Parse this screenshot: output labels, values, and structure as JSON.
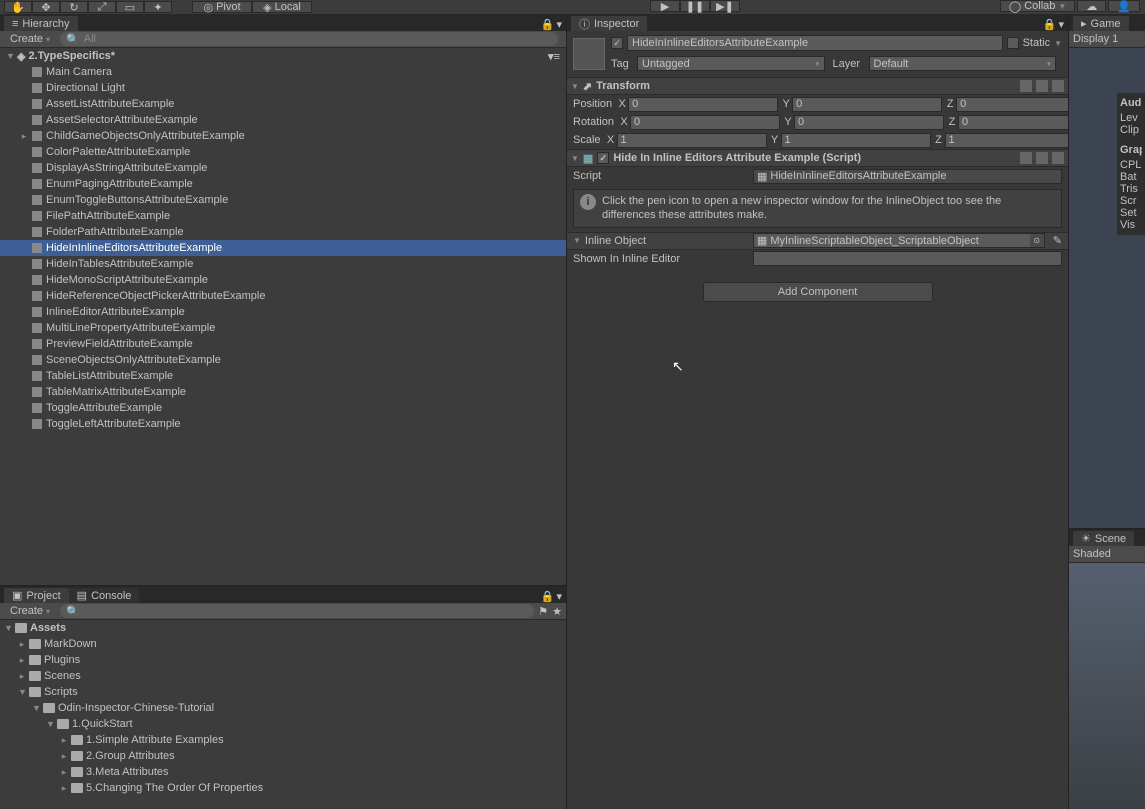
{
  "toolbar": {
    "pivot": "Pivot",
    "local": "Local",
    "collab": "Collab"
  },
  "hierarchy": {
    "tab": "Hierarchy",
    "create": "Create",
    "search_prefix": "All",
    "scene": "2.TypeSpecifics*",
    "items": [
      {
        "name": "Main Camera",
        "fold": false
      },
      {
        "name": "Directional Light",
        "fold": false
      },
      {
        "name": "AssetListAttributeExample",
        "fold": false
      },
      {
        "name": "AssetSelectorAttributeExample",
        "fold": false
      },
      {
        "name": "ChildGameObjectsOnlyAttributeExample",
        "fold": true
      },
      {
        "name": "ColorPaletteAttributeExample",
        "fold": false
      },
      {
        "name": "DisplayAsStringAttributeExample",
        "fold": false
      },
      {
        "name": "EnumPagingAttributeExample",
        "fold": false
      },
      {
        "name": "EnumToggleButtonsAttributeExample",
        "fold": false
      },
      {
        "name": "FilePathAttributeExample",
        "fold": false
      },
      {
        "name": "FolderPathAttributeExample",
        "fold": false
      },
      {
        "name": "HideInInlineEditorsAttributeExample",
        "fold": false,
        "selected": true
      },
      {
        "name": "HideInTablesAttributeExample",
        "fold": false
      },
      {
        "name": "HideMonoScriptAttributeExample",
        "fold": false
      },
      {
        "name": "HideReferenceObjectPickerAttributeExample",
        "fold": false
      },
      {
        "name": "InlineEditorAttributeExample",
        "fold": false
      },
      {
        "name": "MultiLinePropertyAttributeExample",
        "fold": false
      },
      {
        "name": "PreviewFieldAttributeExample",
        "fold": false
      },
      {
        "name": "SceneObjectsOnlyAttributeExample",
        "fold": false
      },
      {
        "name": "TableListAttributeExample",
        "fold": false
      },
      {
        "name": "TableMatrixAttributeExample",
        "fold": false
      },
      {
        "name": "ToggleAttributeExample",
        "fold": false
      },
      {
        "name": "ToggleLeftAttributeExample",
        "fold": false
      }
    ]
  },
  "project": {
    "tab_project": "Project",
    "tab_console": "Console",
    "create": "Create",
    "root": "Assets",
    "tree": [
      {
        "name": "MarkDown",
        "indent": 1,
        "fold": true
      },
      {
        "name": "Plugins",
        "indent": 1,
        "fold": true
      },
      {
        "name": "Scenes",
        "indent": 1,
        "fold": true
      },
      {
        "name": "Scripts",
        "indent": 1,
        "fold": true,
        "open": true
      },
      {
        "name": "Odin-Inspector-Chinese-Tutorial",
        "indent": 2,
        "fold": true,
        "open": true
      },
      {
        "name": "1.QuickStart",
        "indent": 3,
        "fold": true,
        "open": true
      },
      {
        "name": "1.Simple Attribute Examples",
        "indent": 4,
        "fold": true
      },
      {
        "name": "2.Group Attributes",
        "indent": 4,
        "fold": true
      },
      {
        "name": "3.Meta Attributes",
        "indent": 4,
        "fold": true
      },
      {
        "name": "5.Changing The Order Of Properties",
        "indent": 4,
        "fold": true
      }
    ]
  },
  "inspector": {
    "tab": "Inspector",
    "go_name": "HideInInlineEditorsAttributeExample",
    "static": "Static",
    "tag_label": "Tag",
    "tag_value": "Untagged",
    "layer_label": "Layer",
    "layer_value": "Default",
    "transform": {
      "title": "Transform",
      "position": "Position",
      "rotation": "Rotation",
      "scale": "Scale",
      "px": "0",
      "py": "0",
      "pz": "0",
      "rx": "0",
      "ry": "0",
      "rz": "0",
      "sx": "1",
      "sy": "1",
      "sz": "1"
    },
    "script_comp": {
      "title": "Hide In Inline Editors Attribute Example (Script)",
      "script_label": "Script",
      "script_value": "HideInInlineEditorsAttributeExample",
      "info": "Click the pen icon to open a new inspector window for the InlineObject too see the differences these attributes make.",
      "inline_label": "Inline Object",
      "inline_value": "MyInlineScriptableObject_ScriptableObject",
      "shown_label": "Shown In Inline Editor"
    },
    "add_component": "Add Component"
  },
  "game": {
    "tab": "Game",
    "display": "Display 1",
    "overlay_audio": "Audi",
    "overlay_rows1": [
      "Lev",
      "Clip"
    ],
    "overlay_graphics": "Grap",
    "overlay_rows2": [
      "CPL",
      "Bat",
      "Tris",
      "Scr",
      "Set",
      "Vis"
    ]
  },
  "scene": {
    "tab": "Scene",
    "shaded": "Shaded"
  }
}
